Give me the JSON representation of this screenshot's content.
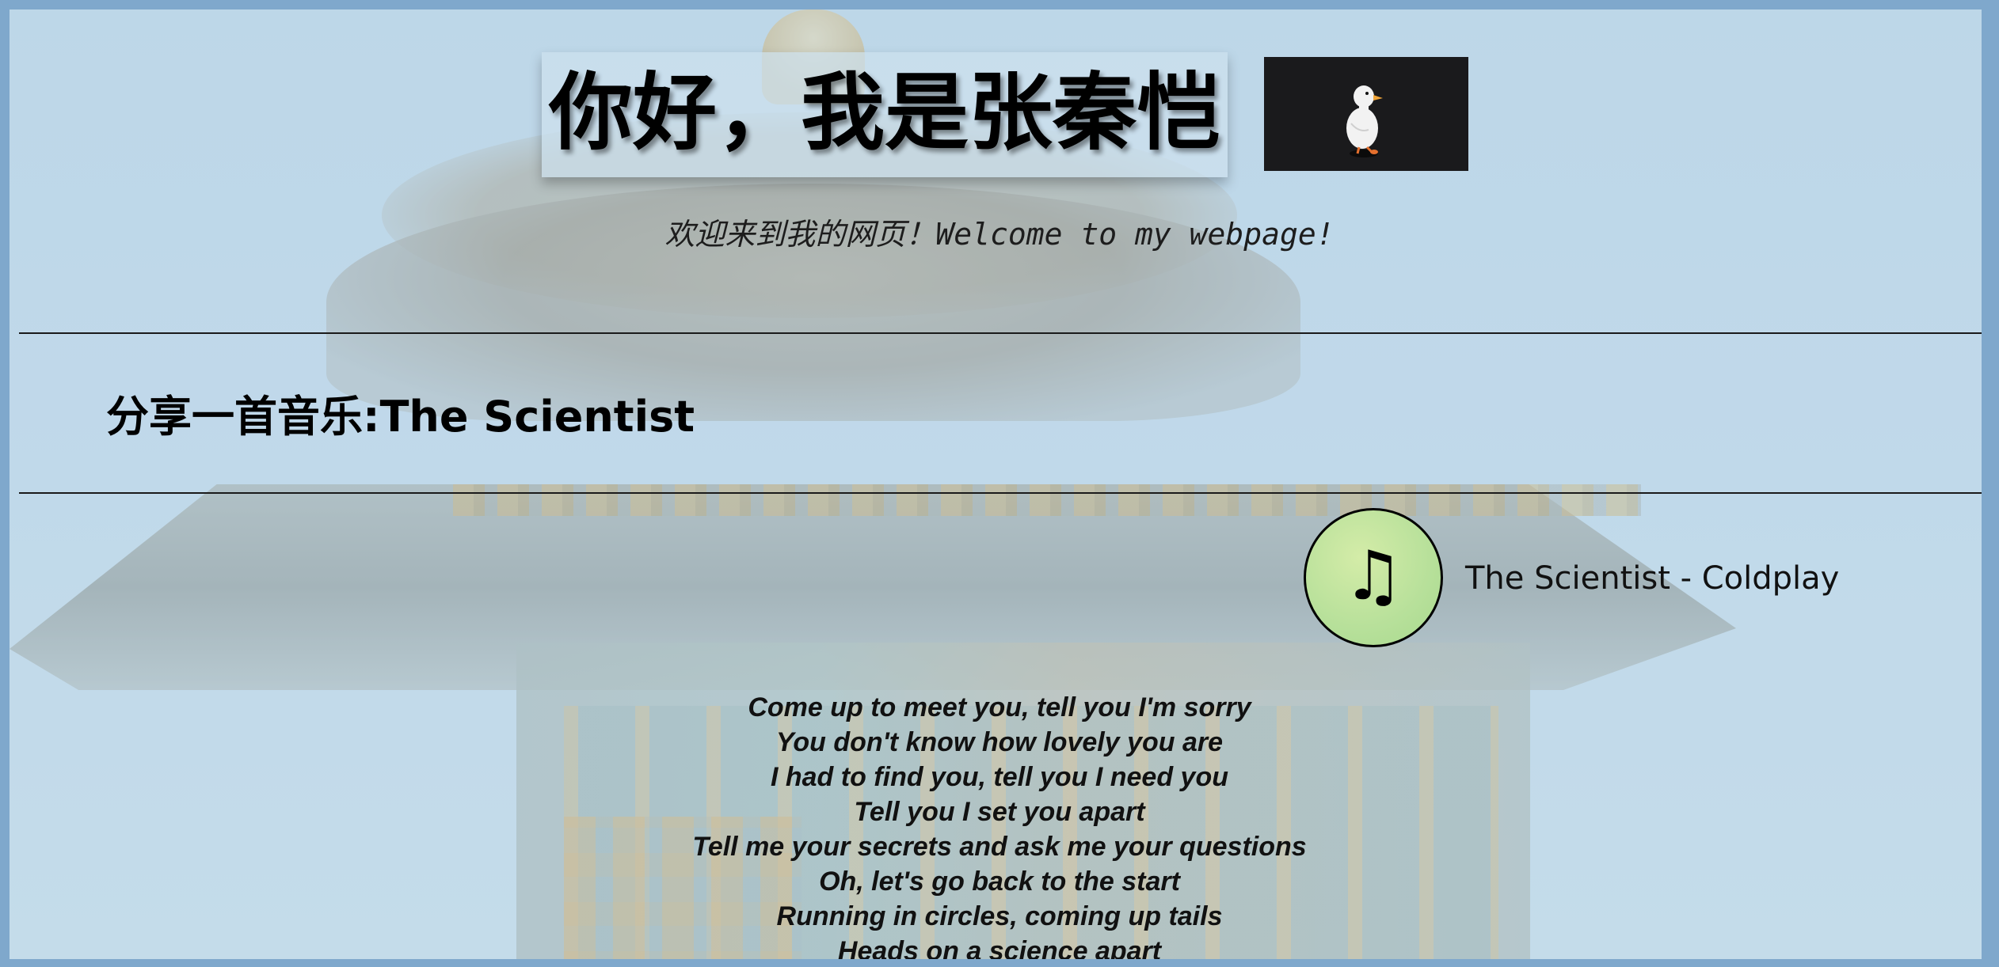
{
  "header": {
    "title": "你好，我是张秦恺",
    "subtitle": "欢迎来到我的网页！Welcome to my webpage!"
  },
  "music_section": {
    "heading": "分享一首音乐:The Scientist",
    "player": {
      "icon": "music-note-icon",
      "icon_glyph": "♫",
      "track_label": "The Scientist - Coldplay"
    },
    "lyrics": [
      "Come up to meet you, tell you I'm sorry",
      "You don't know how lovely you are",
      "I had to find you, tell you I need you",
      "Tell you I set you apart",
      "Tell me your secrets and ask me your questions",
      "Oh, let's go back to the start",
      "Running in circles, coming up tails",
      "Heads on a science apart"
    ]
  },
  "colors": {
    "frame": "#7fa8cc",
    "sky": "#b9d6e8",
    "disc": "#b7e09a",
    "duck_box": "#1a1a1c"
  }
}
